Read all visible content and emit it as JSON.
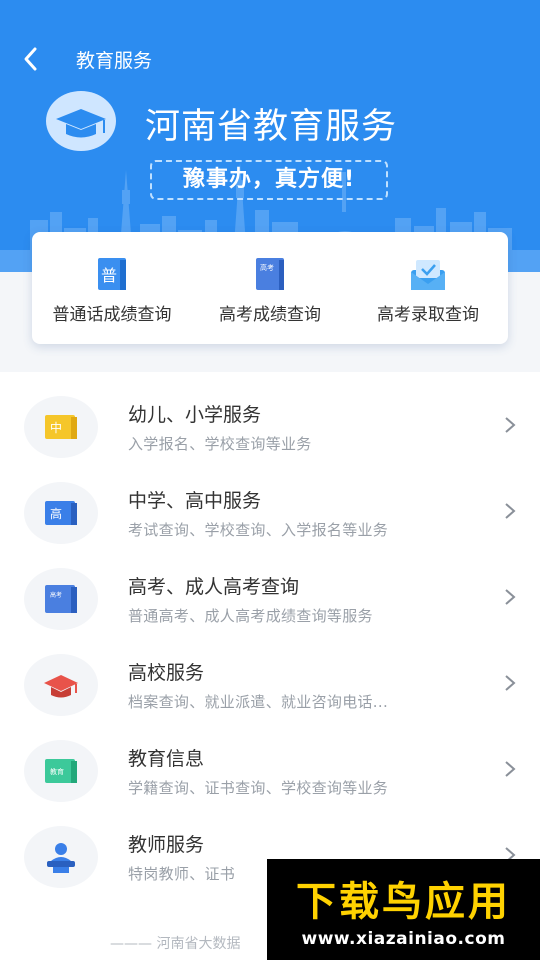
{
  "header": {
    "nav_title": "教育服务",
    "hero_title": "河南省教育服务",
    "slogan": "豫事办，真方便!"
  },
  "quick_actions": [
    {
      "label": "普通话成绩查询",
      "icon": "putonghua-book-icon",
      "glyph": "普"
    },
    {
      "label": "高考成绩查询",
      "icon": "gaokao-book-icon",
      "glyph": "高考"
    },
    {
      "label": "高考录取查询",
      "icon": "admission-mail-icon"
    }
  ],
  "services": [
    {
      "title": "幼儿、小学服务",
      "subtitle": "入学报名、学校查询等业务",
      "icon": "primary-school-book-icon",
      "glyph": "中"
    },
    {
      "title": "中学、高中服务",
      "subtitle": "考试查询、学校查询、入学报名等业务",
      "icon": "high-school-book-icon",
      "glyph": "高"
    },
    {
      "title": "高考、成人高考查询",
      "subtitle": "普通高考、成人高考成绩查询等服务",
      "icon": "gaokao-book-icon",
      "glyph": "高考"
    },
    {
      "title": "高校服务",
      "subtitle": "档案查询、就业派遣、就业咨询电话...",
      "icon": "graduation-cap-icon"
    },
    {
      "title": "教育信息",
      "subtitle": "学籍查询、证书查询、学校查询等业务",
      "icon": "education-book-icon",
      "glyph": "教育"
    },
    {
      "title": "教师服务",
      "subtitle": "特岗教师、证书",
      "icon": "teacher-lectern-icon"
    }
  ],
  "footer": {
    "note": "——— 河南省大数据"
  },
  "watermark": {
    "title": "下载鸟应用",
    "url": "www.xiazainiao.com"
  },
  "colors": {
    "brand_blue": "#2c8cf0",
    "watermark_yellow": "#ffd200"
  }
}
